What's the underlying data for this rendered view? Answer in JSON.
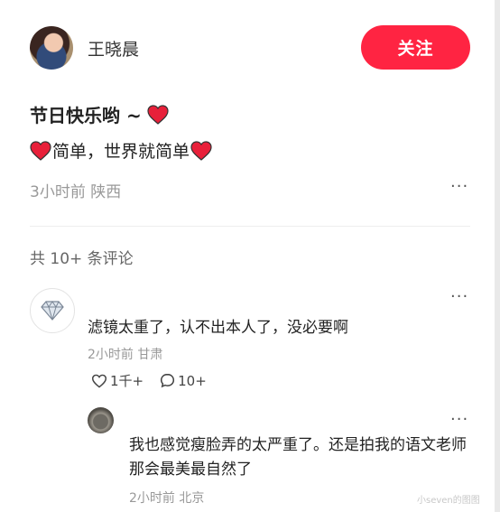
{
  "post": {
    "author": "王晓晨",
    "follow_label": "关注",
    "title": "节日快乐哟 ~",
    "body": "简单，世界就简单",
    "meta": "3小时前 陕西",
    "more": "···"
  },
  "comments_count": "共 10+ 条评论",
  "comment": {
    "text": "滤镜太重了，认不出本人了，没必要啊",
    "meta": "2小时前 甘肃",
    "likes": "1千+",
    "replies": "10+",
    "more": "···"
  },
  "reply": {
    "text": "我也感觉瘦脸弄的太严重了。还是拍我的语文老师那会最美最自然了",
    "meta": "2小时前 北京",
    "more": "···"
  },
  "watermark": "小seven的图图",
  "colors": {
    "accent": "#ff2442",
    "heart": "#e8203a"
  }
}
